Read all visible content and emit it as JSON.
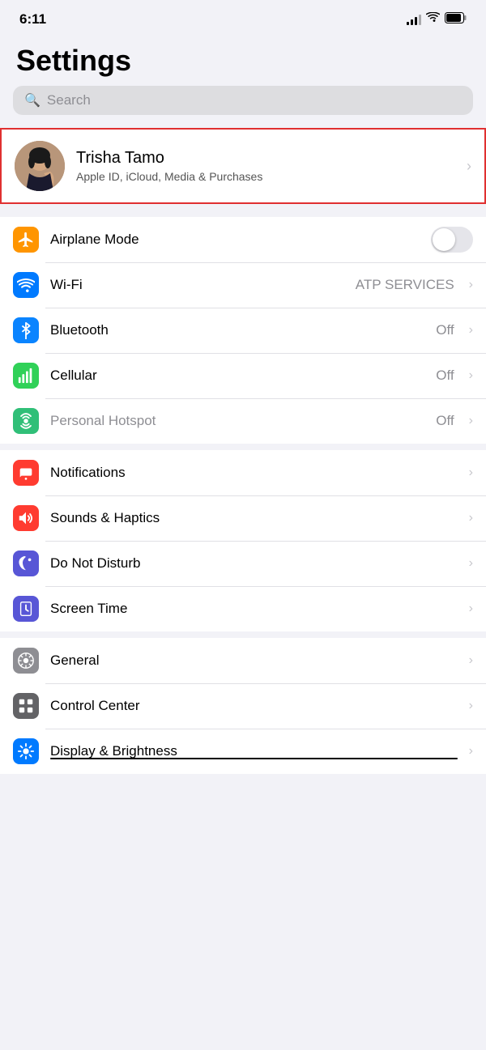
{
  "statusBar": {
    "time": "6:11"
  },
  "page": {
    "title": "Settings"
  },
  "search": {
    "placeholder": "Search"
  },
  "profile": {
    "name": "Trisha Tamo",
    "subtitle": "Apple ID, iCloud, Media & Purchases"
  },
  "connectivitySection": [
    {
      "id": "airplane-mode",
      "label": "Airplane Mode",
      "iconColor": "icon-orange",
      "iconSymbol": "✈",
      "hasToggle": true,
      "toggleOn": false,
      "value": "",
      "hasChevron": false
    },
    {
      "id": "wifi",
      "label": "Wi-Fi",
      "iconColor": "icon-blue",
      "iconSymbol": "wifi",
      "hasToggle": false,
      "value": "ATP SERVICES",
      "hasChevron": true
    },
    {
      "id": "bluetooth",
      "label": "Bluetooth",
      "iconColor": "icon-blue-mid",
      "iconSymbol": "bluetooth",
      "hasToggle": false,
      "value": "Off",
      "hasChevron": true
    },
    {
      "id": "cellular",
      "label": "Cellular",
      "iconColor": "icon-green-cell",
      "iconSymbol": "cellular",
      "hasToggle": false,
      "value": "Off",
      "hasChevron": true
    },
    {
      "id": "personal-hotspot",
      "label": "Personal Hotspot",
      "iconColor": "icon-green-hotspot",
      "iconSymbol": "hotspot",
      "hasToggle": false,
      "value": "Off",
      "hasChevron": true,
      "disabled": true
    }
  ],
  "notificationSection": [
    {
      "id": "notifications",
      "label": "Notifications",
      "iconColor": "icon-red",
      "iconSymbol": "notifications",
      "value": "",
      "hasChevron": true
    },
    {
      "id": "sounds-haptics",
      "label": "Sounds & Haptics",
      "iconColor": "icon-red-sound",
      "iconSymbol": "sound",
      "value": "",
      "hasChevron": true
    },
    {
      "id": "do-not-disturb",
      "label": "Do Not Disturb",
      "iconColor": "icon-purple",
      "iconSymbol": "moon",
      "value": "",
      "hasChevron": true
    },
    {
      "id": "screen-time",
      "label": "Screen Time",
      "iconColor": "icon-purple-screen",
      "iconSymbol": "hourglass",
      "value": "",
      "hasChevron": true
    }
  ],
  "generalSection": [
    {
      "id": "general",
      "label": "General",
      "iconColor": "icon-gray",
      "iconSymbol": "gear",
      "value": "",
      "hasChevron": true
    },
    {
      "id": "control-center",
      "label": "Control Center",
      "iconColor": "icon-gray2",
      "iconSymbol": "sliders",
      "value": "",
      "hasChevron": true
    },
    {
      "id": "display-brightness",
      "label": "Display & Brightness",
      "iconColor": "icon-blue-display",
      "iconSymbol": "sun",
      "value": "",
      "hasChevron": true,
      "strikethrough": true
    }
  ]
}
